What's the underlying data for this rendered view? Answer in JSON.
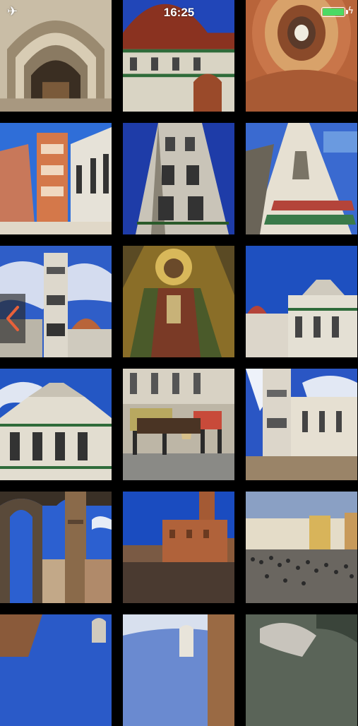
{
  "status_bar": {
    "time": "16:25",
    "airplane_icon": "airplane-icon",
    "battery_icon": "battery-icon",
    "battery_level": 1.0,
    "battery_color": "#4cd964",
    "charging_icon": "bolt-icon"
  },
  "navigation": {
    "back_icon": "chevron-left-icon",
    "back_color": "#e8613a"
  },
  "gallery": {
    "columns": 3,
    "photos": [
      {
        "subject": "cathedral-portal"
      },
      {
        "subject": "duomo-dome"
      },
      {
        "subject": "dome-fresco"
      },
      {
        "subject": "duomo-facade-and-campanile"
      },
      {
        "subject": "campanile-looking-up"
      },
      {
        "subject": "campanile-corner"
      },
      {
        "subject": "campanile-and-dome"
      },
      {
        "subject": "christ-mosaic"
      },
      {
        "subject": "baptistery-and-cathedral"
      },
      {
        "subject": "baptistery"
      },
      {
        "subject": "horse-carriages"
      },
      {
        "subject": "piazza-del-duomo-sunburst"
      },
      {
        "subject": "loggia-arches"
      },
      {
        "subject": "palazzo-vecchio"
      },
      {
        "subject": "piazza-crowd"
      },
      {
        "subject": "statue-and-palazzo"
      },
      {
        "subject": "neptune-fountain"
      },
      {
        "subject": "marble-sculpture"
      }
    ]
  }
}
